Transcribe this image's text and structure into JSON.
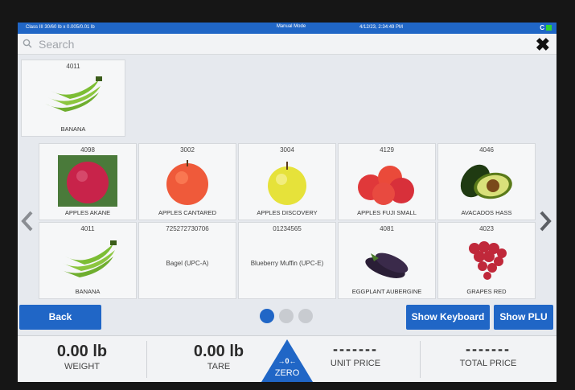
{
  "status": {
    "left": "Class III 30/60 lb x 0.005/0.01 lb",
    "mode": "Manual Mode",
    "datetime": "4/12/23, 2:34:49 PM",
    "conn": "C"
  },
  "search": {
    "placeholder": "Search"
  },
  "recent": {
    "plu": "4011",
    "name": "BANANA"
  },
  "grid": [
    {
      "plu": "4098",
      "name": "APPLES AKANE",
      "image": "red-apple"
    },
    {
      "plu": "3002",
      "name": "APPLES CANTARED",
      "image": "red-apple"
    },
    {
      "plu": "3004",
      "name": "APPLES DISCOVERY",
      "image": "yellow-apple"
    },
    {
      "plu": "4129",
      "name": "APPLES FUJI SMALL",
      "image": "apples"
    },
    {
      "plu": "4046",
      "name": "AVACADOS HASS",
      "image": "avocado"
    },
    {
      "plu": "4011",
      "name": "BANANA",
      "image": "banana"
    },
    {
      "plu": "725272730706",
      "name": "Bagel (UPC-A)",
      "image": ""
    },
    {
      "plu": "01234565",
      "name": "Blueberry Muffin (UPC-E)",
      "image": ""
    },
    {
      "plu": "4081",
      "name": "EGGPLANT AUBERGINE",
      "image": "eggplant"
    },
    {
      "plu": "4023",
      "name": "GRAPES RED",
      "image": "grapes"
    }
  ],
  "buttons": {
    "back": "Back",
    "show_keyboard": "Show Keyboard",
    "show_plu": "Show PLU"
  },
  "weighing": {
    "weight_value": "0.00 lb",
    "weight_label": "WEIGHT",
    "tare_value": "0.00 lb",
    "tare_label": "TARE",
    "zero_label": "ZERO",
    "zero_symbol": "→0←",
    "unit_price_value": "-------",
    "unit_price_label": "UNIT PRICE",
    "total_price_value": "-------",
    "total_price_label": "TOTAL PRICE"
  },
  "colors": {
    "accent": "#2066c6",
    "status_ok": "#2fd42f"
  }
}
